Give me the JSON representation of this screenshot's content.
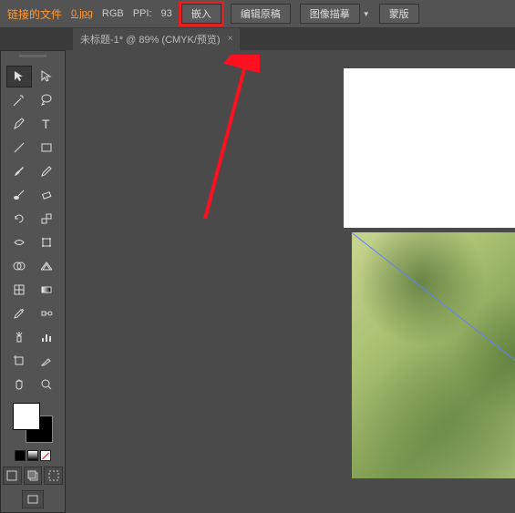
{
  "topbar": {
    "linked_label": "链接的文件",
    "filename": "0.jpg",
    "color_mode": "RGB",
    "ppi_label": "PPI:",
    "ppi_value": "93",
    "embed_btn": "嵌入",
    "edit_original_btn": "编辑原稿",
    "image_trace_btn": "图像描摹",
    "mask_btn": "蒙版"
  },
  "tab": {
    "title": "未标题-1* @ 89% (CMYK/预览)",
    "close": "×"
  },
  "colors": {
    "foreground": "#ffffff",
    "background": "#000000",
    "swatches": [
      "#000000",
      "#ffffff",
      "#ff0000"
    ]
  }
}
